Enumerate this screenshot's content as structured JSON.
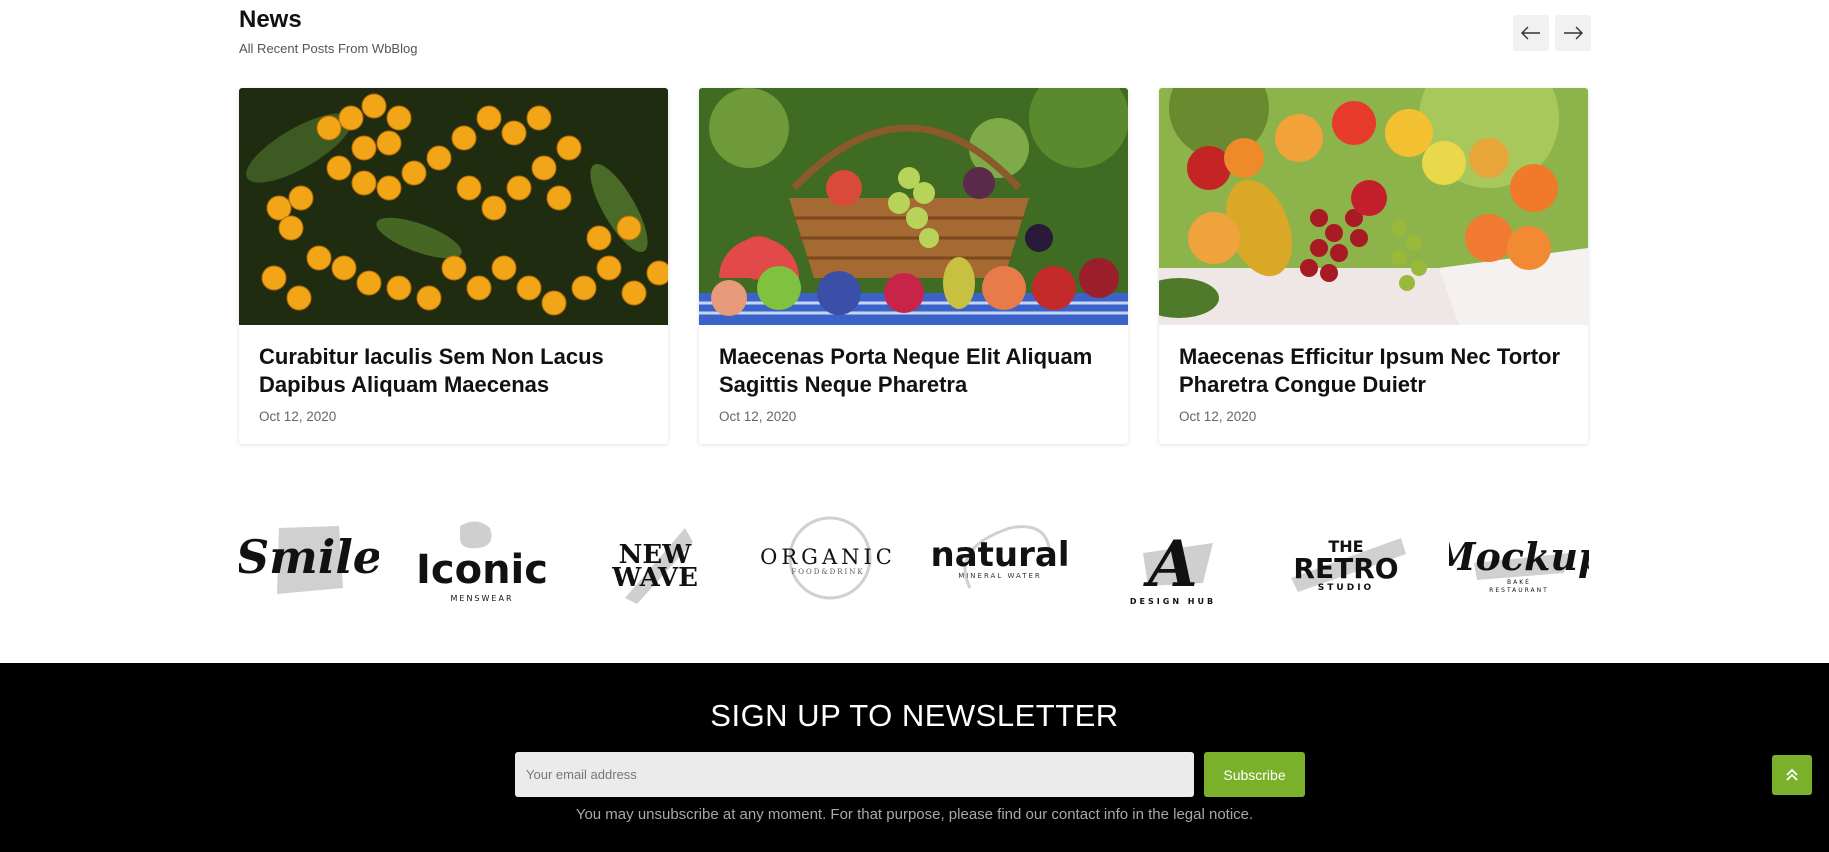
{
  "news": {
    "title": "News",
    "subtitle": "All Recent Posts From WbBlog"
  },
  "nav": {
    "prev_icon": "arrow-left-icon",
    "next_icon": "arrow-right-icon"
  },
  "posts": [
    {
      "title": "Curabitur Iaculis Sem Non Lacus Dapibus Aliquam Maecenas",
      "date": "Oct 12, 2020",
      "image": "orange-berries-photo"
    },
    {
      "title": "Maecenas Porta Neque Elit Aliquam Sagittis Neque Pharetra",
      "date": "Oct 12, 2020",
      "image": "fruit-basket-photo"
    },
    {
      "title": "Maecenas Efficitur Ipsum Nec Tortor Pharetra Congue Duietr",
      "date": "Oct 12, 2020",
      "image": "fruit-table-photo"
    }
  ],
  "brands": [
    {
      "name": "Smile"
    },
    {
      "name": "Iconic",
      "tag": "MENSWEAR"
    },
    {
      "name": "NEW WAVE"
    },
    {
      "name": "ORGANIC",
      "tag": "FOOD&DRINK"
    },
    {
      "name": "natural",
      "tag": "MINERAL WATER"
    },
    {
      "name": "A",
      "tag": "DESIGN HUB"
    },
    {
      "name": "THE RETRO",
      "tag": "STUDIO"
    },
    {
      "name": "Mockup",
      "tag": "BAKE RESTAURANT"
    }
  ],
  "newsletter": {
    "title": "SIGN UP TO NEWSLETTER",
    "placeholder": "Your email address",
    "button": "Subscribe",
    "note": "You may unsubscribe at any moment. For that purpose, please find our contact info in the legal notice."
  },
  "colors": {
    "accent": "#7ab02a",
    "footer_bg": "#000000"
  },
  "back_to_top_icon": "chevron-double-up-icon"
}
